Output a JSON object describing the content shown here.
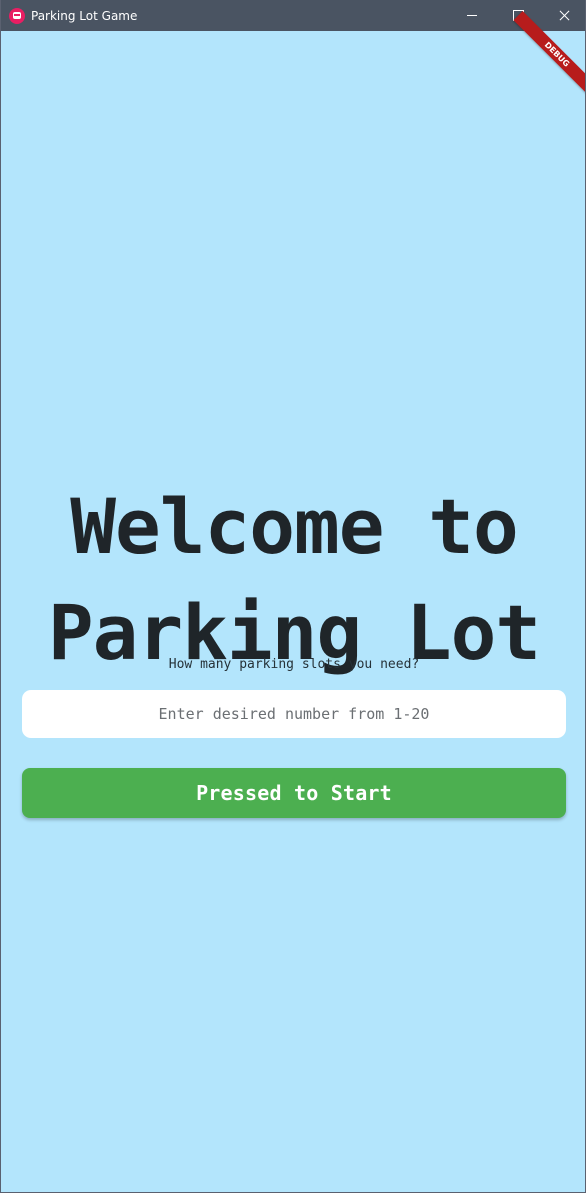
{
  "window": {
    "title": "Parking Lot Game",
    "controls": [
      "minimize",
      "maximize",
      "close"
    ]
  },
  "debug_banner": {
    "label": "DEBUG"
  },
  "main": {
    "headline_line_1": "Welcome to",
    "headline_line_2": "Parking Lot",
    "prompt": "How many parking slots you need?",
    "input": {
      "value": "",
      "placeholder": "Enter desired number from 1-20"
    },
    "start_button": "Pressed to Start"
  },
  "icons": {
    "app": "parking-car-icon",
    "minimize": "minimize-icon",
    "maximize": "maximize-icon",
    "close": "close-icon"
  },
  "colors": {
    "titlebar": "#4a5462",
    "background": "#b3e5fc",
    "input_background": "#ffffff",
    "button": "#4caf50",
    "debug_banner": "#b71c1c",
    "text": "#1f2529"
  }
}
